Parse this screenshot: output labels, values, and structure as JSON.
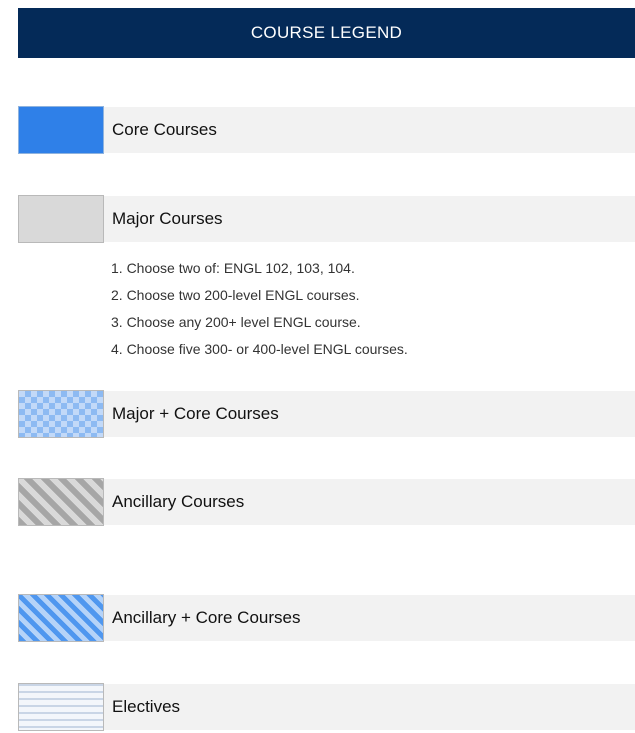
{
  "header": {
    "title": "COURSE LEGEND"
  },
  "legend": [
    {
      "label": "Core Courses",
      "swatch": "solid",
      "color": "#2f80e8"
    },
    {
      "label": "Major Courses",
      "swatch": "solid",
      "color": "#d9d9d9"
    },
    {
      "label": "Major + Core Courses",
      "swatch": "checkerboard",
      "color": "#8dbaf2"
    },
    {
      "label": "Ancillary Courses",
      "swatch": "diagonal-stripes",
      "color": "#a6a6a6"
    },
    {
      "label": "Ancillary + Core Courses",
      "swatch": "diagonal-stripes",
      "color": "#4f97ef"
    },
    {
      "label": "Electives",
      "swatch": "horizontal-stripes",
      "color": "#c9d5e6"
    }
  ],
  "major_notes": [
    "1. Choose two of: ENGL 102, 103, 104.",
    "2. Choose two 200-level ENGL courses.",
    "3. Choose any 200+ level ENGL course.",
    "4. Choose five 300- or 400-level ENGL courses."
  ],
  "colors": {
    "header_bg": "#042a58",
    "label_bar_bg": "#f2f2f2"
  }
}
